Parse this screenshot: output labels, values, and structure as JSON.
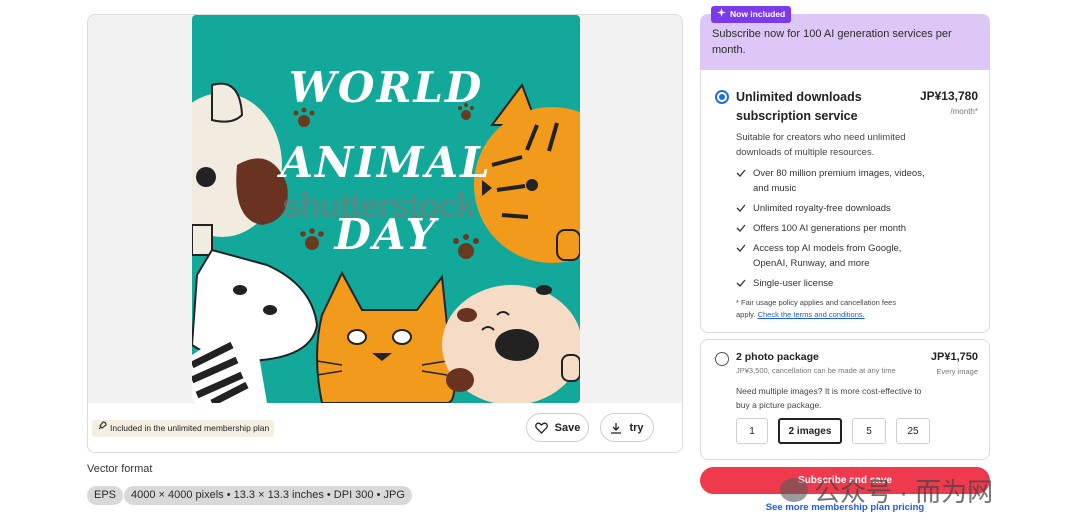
{
  "preview": {
    "poster_title_lines": [
      "WORLD",
      "ANIMAL",
      "DAY"
    ],
    "watermark": "shutterstock",
    "membership_chip": "Included in the unlimited membership plan",
    "save_label": "Save",
    "try_label": "try"
  },
  "file_info": {
    "format_label": "Vector format",
    "format_chip": "EPS",
    "spec_chip": "4000 × 4000 pixels • 13.3 × 13.3 inches • DPI 300 • JPG"
  },
  "promo": {
    "badge": "Now included",
    "text": "Subscribe now for 100 AI generation services per month."
  },
  "plan_unlimited": {
    "name": "Unlimited downloads subscription service",
    "price": "JP¥13,780",
    "period": "/month*",
    "description": "Suitable for creators who need unlimited downloads of multiple resources.",
    "features": [
      "Over 80 million premium images, videos, and music",
      "Unlimited royalty-free downloads",
      "Offers 100 AI generations per month",
      "Access top AI models from Google, OpenAI, Runway, and more",
      "Single-user license"
    ],
    "fair_note": "* Fair usage policy applies and cancellation fees apply.",
    "terms_link": "Check the terms and conditions."
  },
  "plan_photo": {
    "name": "2 photo package",
    "sub": "JP¥3,500, cancellation can be made at any time",
    "price": "JP¥1,750",
    "each": "Every image",
    "description": "Need multiple images? It is more cost-effective to buy a picture package.",
    "quantities": [
      "1",
      "2 images",
      "5",
      "25"
    ],
    "selected_quantity": "2 images"
  },
  "cta": {
    "subscribe_label": "Subscribe and save",
    "pricing_link": "See more membership plan pricing"
  },
  "overlay_watermark": "公众号 · 而为网",
  "colors": {
    "poster_bg": "#12a99a",
    "promo_bg": "#ddc7f7",
    "badge": "#7c3aed",
    "subscribe": "#ee3a4c",
    "link": "#1f5fd6",
    "radio_checked": "#1f6fe0"
  }
}
